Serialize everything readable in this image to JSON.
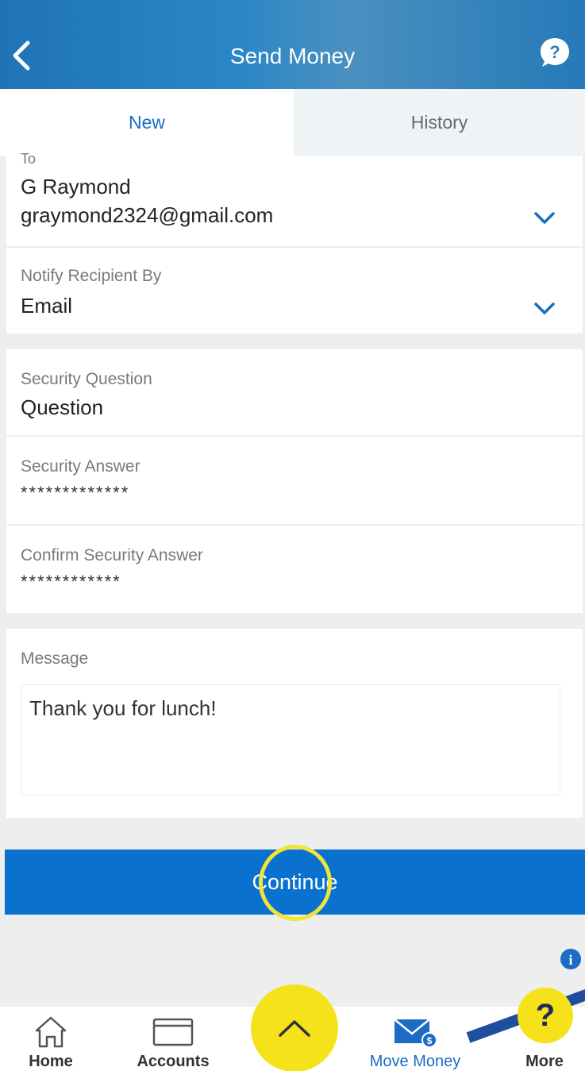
{
  "header": {
    "title": "Send Money"
  },
  "tabs": [
    {
      "label": "New",
      "active": true
    },
    {
      "label": "History",
      "active": false
    }
  ],
  "form": {
    "to": {
      "label": "To",
      "name": "G Raymond",
      "email": "graymond2324@gmail.com"
    },
    "notify": {
      "label": "Notify Recipient By",
      "value": "Email"
    },
    "security_question": {
      "label": "Security Question",
      "value": "Question"
    },
    "security_answer": {
      "label": "Security Answer",
      "value": "*************"
    },
    "confirm_security_answer": {
      "label": "Confirm Security Answer",
      "value": "************"
    },
    "message": {
      "label": "Message",
      "value": "Thank you for lunch!"
    }
  },
  "continue_label": "Continue",
  "bottom_nav": {
    "items": [
      {
        "label": "Home",
        "icon": "home-icon"
      },
      {
        "label": "Accounts",
        "icon": "card-icon"
      },
      {
        "label": "Move Money",
        "icon": "envelope-dollar-icon",
        "active": true
      },
      {
        "label": "More",
        "icon": "more-icon"
      }
    ]
  },
  "colors": {
    "primary": "#0a72ce",
    "accent_yellow": "#f5e21a",
    "header": "#1f73b7"
  }
}
